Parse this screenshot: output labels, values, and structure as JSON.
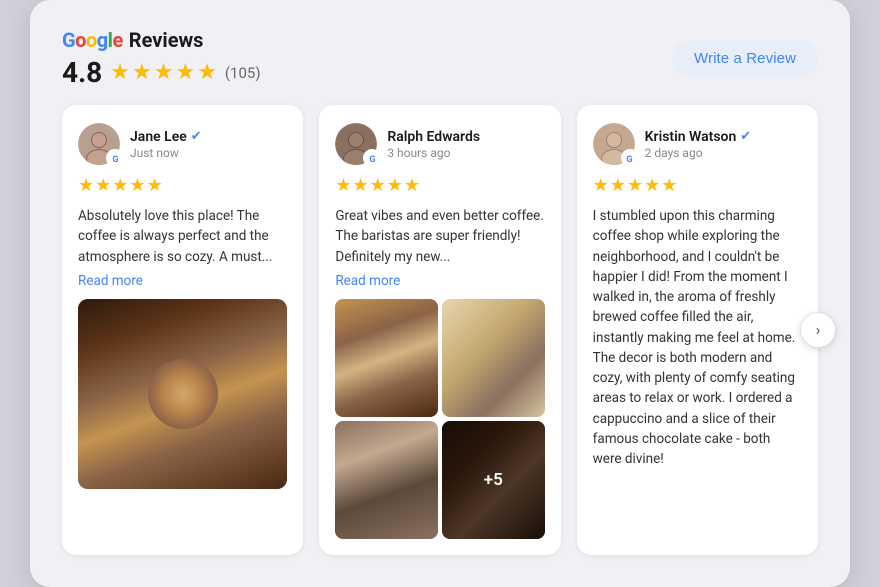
{
  "widget": {
    "title": {
      "google": "Google",
      "reviews": "Reviews"
    },
    "rating": {
      "number": "4.8",
      "count": "(105)"
    },
    "write_review_label": "Write a Review",
    "stars": [
      "★",
      "★",
      "★",
      "★",
      "★"
    ]
  },
  "reviews": [
    {
      "id": "review-1",
      "reviewer": {
        "name": "Jane Lee",
        "time": "Just now",
        "verified": true
      },
      "stars": 5,
      "text": "Absolutely love this place! The coffee is always perfect and the atmosphere is so cozy. A must...",
      "read_more": "Read more",
      "has_images": true,
      "image_type": "single"
    },
    {
      "id": "review-2",
      "reviewer": {
        "name": "Ralph Edwards",
        "time": "3 hours ago",
        "verified": false
      },
      "stars": 5,
      "text": "Great vibes and even better coffee. The baristas are super friendly! Definitely my new...",
      "read_more": "Read more",
      "has_images": true,
      "image_type": "grid"
    },
    {
      "id": "review-3",
      "reviewer": {
        "name": "Kristin Watson",
        "time": "2 days ago",
        "verified": true
      },
      "stars": 5,
      "text": "I stumbled upon this charming coffee shop while exploring the neighborhood, and I couldn't be happier I did! From the moment I walked in, the aroma of freshly brewed coffee filled the air, instantly making me feel at home. The decor is both modern and cozy, with plenty of comfy seating areas to relax or work. I ordered a cappuccino and a slice of their famous chocolate cake - both were divine!",
      "read_more": null,
      "has_images": false,
      "image_type": "none"
    }
  ],
  "nav": {
    "next_arrow": "›"
  },
  "grid_overlay": "+5"
}
